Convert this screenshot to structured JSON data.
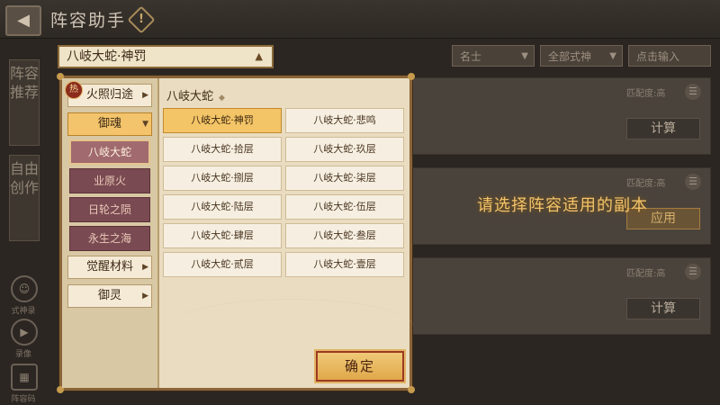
{
  "header": {
    "title": "阵容助手",
    "back_icon": "back-arrow-icon",
    "warn_glyph": "!"
  },
  "filters": {
    "filter1": "名士",
    "filter2": "全部式神",
    "search_placeholder": "点击输入"
  },
  "sidenav": {
    "tab1": "阵容推荐",
    "tab2": "自由创作",
    "btn1": "式神录",
    "btn2": "录像",
    "btn3": "阵容码"
  },
  "cards": [
    {
      "match": "匹配度:高",
      "action": "计算"
    },
    {
      "match": "匹配度:高",
      "action": "应用"
    },
    {
      "match": "匹配度:高",
      "action": "计算"
    }
  ],
  "hint_text": "请选择阵容适用的副本",
  "dropdown": {
    "selected": "八岐大蛇·神罚"
  },
  "categories": {
    "hot_badge": "热",
    "items": [
      "火照归途",
      "御魂",
      "觉醒材料",
      "御灵"
    ],
    "sub_items": [
      "八岐大蛇",
      "业原火",
      "日轮之陨",
      "永生之海"
    ]
  },
  "section_title": "八岐大蛇",
  "options": [
    "八岐大蛇·神罚",
    "八岐大蛇·悲鸣",
    "八岐大蛇·拾层",
    "八岐大蛇·玖层",
    "八岐大蛇·捌层",
    "八岐大蛇·柒层",
    "八岐大蛇·陆层",
    "八岐大蛇·伍层",
    "八岐大蛇·肆层",
    "八岐大蛇·叁层",
    "八岐大蛇·贰层",
    "八岐大蛇·壹层"
  ],
  "confirm_label": "确定",
  "colors": {
    "accent": "#f4c567",
    "hint": "#f2c36a",
    "sub_active": "#a06a6e",
    "sub_default": "#7a4a52"
  }
}
